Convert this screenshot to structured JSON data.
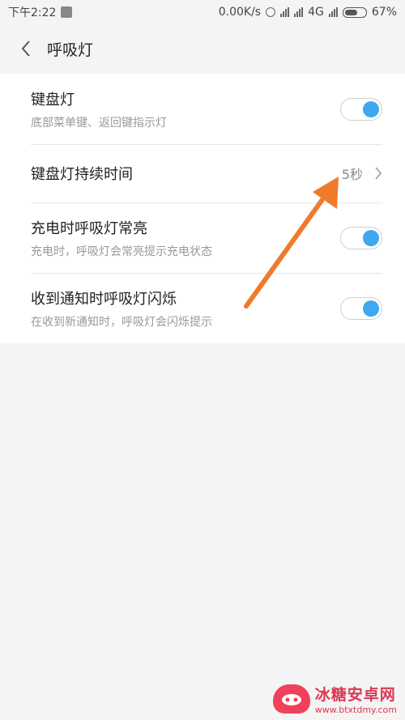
{
  "status_bar": {
    "time": "下午2:22",
    "speed": "0.00K/s",
    "network": "4G",
    "battery": "67%",
    "battery_level": 0.67
  },
  "header": {
    "title": "呼吸灯"
  },
  "settings": [
    {
      "label": "键盘灯",
      "desc": "底部菜单键、返回键指示灯",
      "toggle_on": true
    },
    {
      "label": "键盘灯持续时间",
      "value": "5秒"
    },
    {
      "label": "充电时呼吸灯常亮",
      "desc": "充电时，呼吸灯会常亮提示充电状态",
      "toggle_on": true
    },
    {
      "label": "收到通知时呼吸灯闪烁",
      "desc": "在收到新通知时，呼吸灯会闪烁提示",
      "toggle_on": true
    }
  ],
  "watermark": {
    "title": "冰糖安卓网",
    "url": "www.btxtdmy.com"
  },
  "colors": {
    "accent": "#3ea8f0",
    "annotation_arrow": "#f07a2c"
  }
}
